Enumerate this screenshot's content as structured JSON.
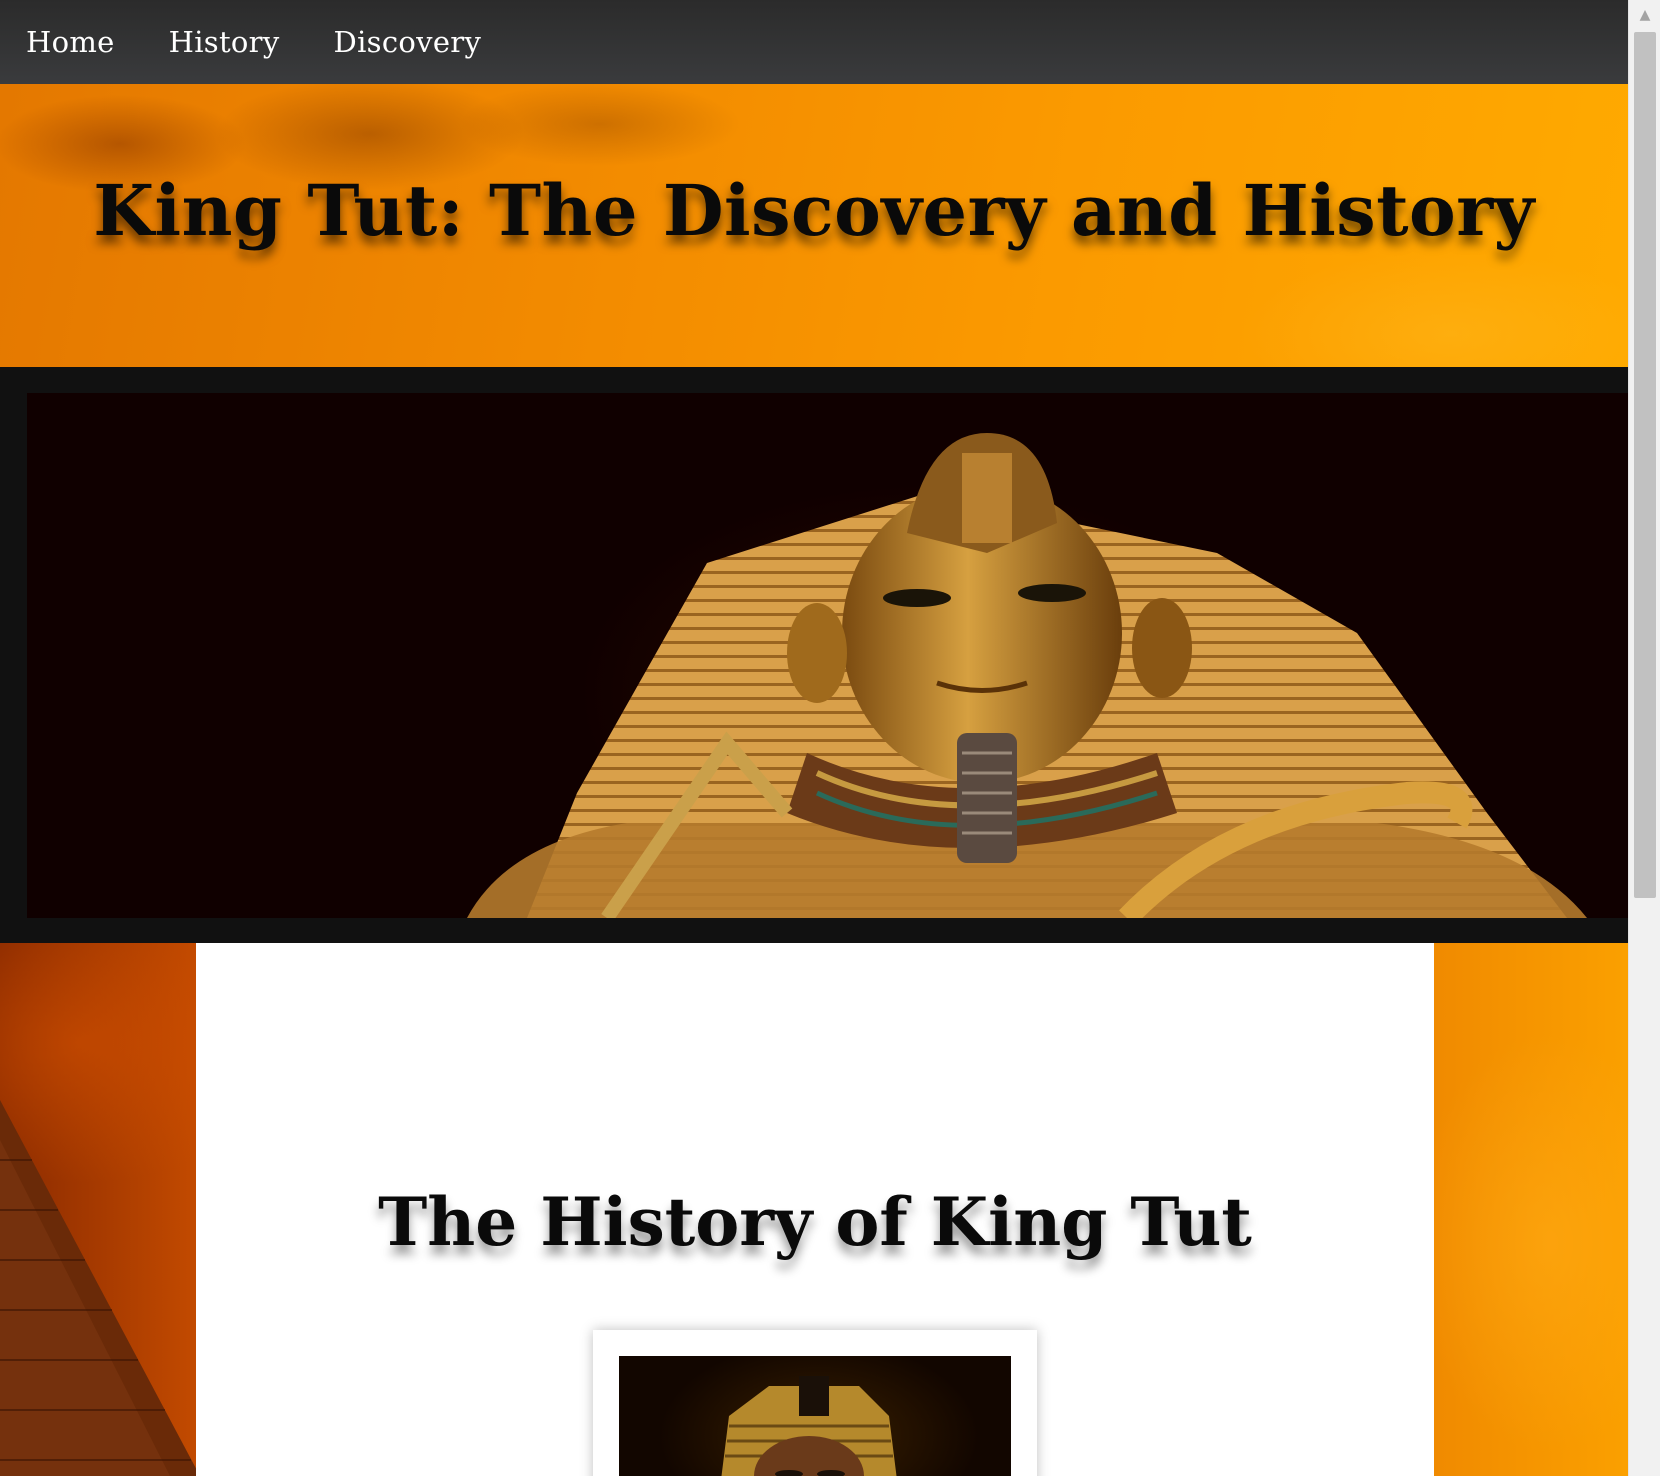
{
  "nav": {
    "items": [
      {
        "label": "Home"
      },
      {
        "label": "History"
      },
      {
        "label": "Discovery"
      }
    ]
  },
  "header": {
    "title": "King Tut: The Discovery and History"
  },
  "hero": {
    "image": "pharaoh-golden-mask"
  },
  "content": {
    "section_title": "The History of King Tut",
    "image": "king-tut-statue"
  },
  "scrollbar": {
    "up_arrow": "▲",
    "position_fraction": 0.0
  }
}
